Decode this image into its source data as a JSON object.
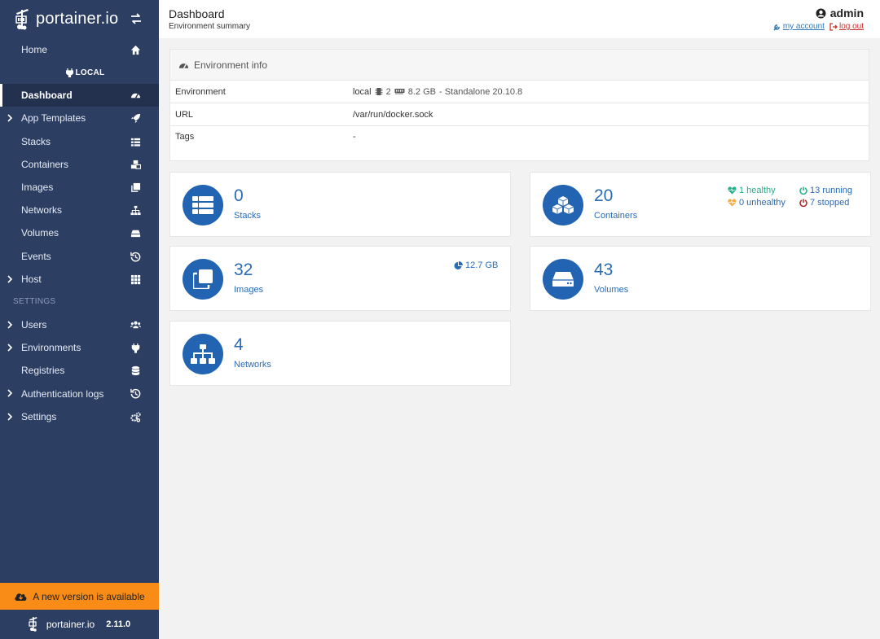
{
  "brand": {
    "name": "portainer.io"
  },
  "sidebar": {
    "home": "Home",
    "environment": "LOCAL",
    "items": [
      {
        "label": "Dashboard",
        "icon": "tachometer-icon"
      },
      {
        "label": "App Templates",
        "icon": "rocket-icon"
      },
      {
        "label": "Stacks",
        "icon": "th-list-icon"
      },
      {
        "label": "Containers",
        "icon": "cubes-icon"
      },
      {
        "label": "Images",
        "icon": "clone-icon"
      },
      {
        "label": "Networks",
        "icon": "sitemap-icon"
      },
      {
        "label": "Volumes",
        "icon": "hdd-icon"
      },
      {
        "label": "Events",
        "icon": "history-icon"
      },
      {
        "label": "Host",
        "icon": "th-icon"
      }
    ],
    "settings_title": "SETTINGS",
    "settings_items": [
      {
        "label": "Users",
        "icon": "users-icon"
      },
      {
        "label": "Environments",
        "icon": "plug-icon"
      },
      {
        "label": "Registries",
        "icon": "database-icon"
      },
      {
        "label": "Authentication logs",
        "icon": "history-icon"
      },
      {
        "label": "Settings",
        "icon": "cogs-icon"
      }
    ],
    "update_banner": "A new version is available",
    "footer_brand": "portainer.io",
    "version": "2.11.0"
  },
  "header": {
    "title": "Dashboard",
    "subtitle": "Environment summary",
    "username": "admin",
    "my_account": "my account",
    "log_out": "log out"
  },
  "env_info": {
    "title": "Environment info",
    "rows": {
      "environment": {
        "key": "Environment",
        "name": "local",
        "cpu": "2",
        "memory": "8.2 GB",
        "details": "- Standalone 20.10.8"
      },
      "url": {
        "key": "URL",
        "value": "/var/run/docker.sock"
      },
      "tags": {
        "key": "Tags",
        "value": "-"
      }
    }
  },
  "cards": {
    "stacks": {
      "count": "0",
      "label": "Stacks"
    },
    "containers": {
      "count": "20",
      "label": "Containers",
      "healthy": "1 healthy",
      "unhealthy": "0 unhealthy",
      "running": "13 running",
      "stopped": "7 stopped"
    },
    "images": {
      "count": "32",
      "label": "Images",
      "size": "12.7 GB"
    },
    "volumes": {
      "count": "43",
      "label": "Volumes"
    },
    "networks": {
      "count": "4",
      "label": "Networks"
    }
  },
  "colors": {
    "sidebar": "#2d3e63",
    "accent": "#2264b2",
    "update_banner": "#f98c17",
    "healthy": "#23ae89",
    "unhealthy": "#f0ad4e",
    "running": "#23ae89",
    "stopped": "#ae2323"
  }
}
